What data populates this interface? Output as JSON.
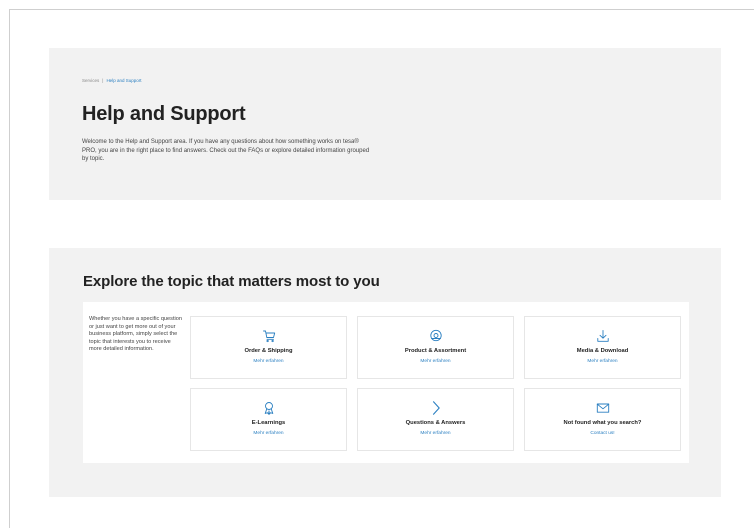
{
  "breadcrumb": {
    "root": "Services",
    "separator": "|",
    "current": "Help and Support"
  },
  "hero": {
    "title": "Help and Support",
    "description": "Welcome to the Help and Support area. If you have any questions about how something works on tesa® PRO, you are in the right place to find answers. Check out the FAQs or explore detailed information grouped by topic."
  },
  "topics": {
    "heading": "Explore the topic that matters most to you",
    "intro": "Whether you have a specific question or just want to get more out of your business platform, simply select the topic that interests you to receive more detailed information.",
    "cards": [
      {
        "icon": "cart-icon",
        "title": "Order & Shipping",
        "link": "Mehr erfahren"
      },
      {
        "icon": "tape-roll-icon",
        "title": "Product & Assortment",
        "link": "Mehr erfahren"
      },
      {
        "icon": "download-icon",
        "title": "Media & Download",
        "link": "Mehr erfahren"
      },
      {
        "icon": "award-icon",
        "title": "E-Learnings",
        "link": "Mehr erfahren"
      },
      {
        "icon": "chevron-right-icon",
        "title": "Questions & Answers",
        "link": "Mehr erfahren"
      },
      {
        "icon": "envelope-icon",
        "title": "Not found what you search?",
        "link": "Contact us!"
      }
    ]
  },
  "colors": {
    "accent": "#2a7fc1",
    "section_bg": "#f2f2f2",
    "card_border": "#e6e6e6"
  }
}
